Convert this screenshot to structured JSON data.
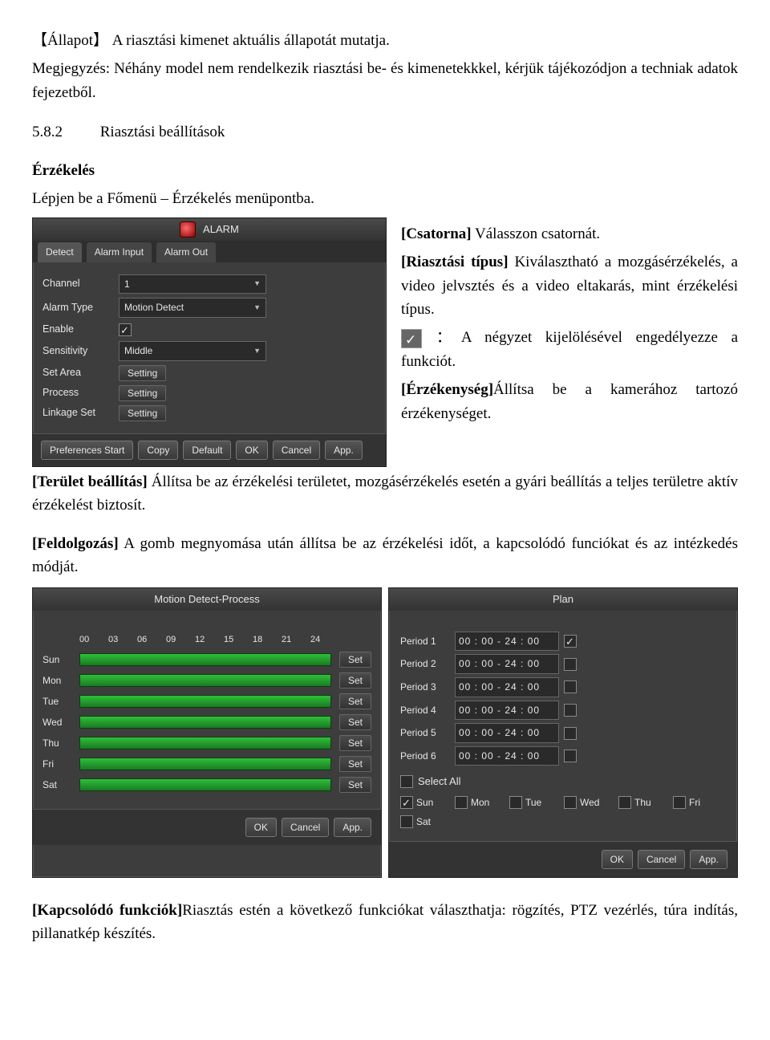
{
  "doc": {
    "line1_pre": "【Állapot】",
    "line1_rest": "A riasztási kimenet aktuális állapotát mutatja.",
    "line2": "Megjegyzés: Néhány model nem rendelkezik riasztási be- és kimenetekkkel, kérjük tájékozódjon a techniak adatok fejezetből.",
    "sec_num": "5.8.2",
    "sec_title": "Riasztási beállítások",
    "sense_h": "Érzékelés",
    "sense_p": "Lépjen be a Főmenü – Érzékelés menüpontba.",
    "ch_label": "[Csatorna]",
    "ch_text": " Válasszon csatornát.",
    "rt_label": "[Riasztási típus]",
    "rt_text": " Kiválasztható a mozgásérzékelés, a video jelvsztés és a video eltakarás, mint érzékelési típus.",
    "chk_text": "：A négyzet kijelölésével engedélyezze a funkciót.",
    "sens_label": "[Érzékenység]",
    "sens_text": "Állítsa be a kamerához tartozó érzékenységet.",
    "area_label": "[Terület beállítás]",
    "area_text": " Állítsa be az érzékelési területet, mozgásérzékelés esetén a gyári beállítás a teljes területre aktív érzékelést biztosít.",
    "proc_label": "[Feldolgozás]",
    "proc_text": " A gomb megnyomása után állítsa be az érzékelési időt, a kapcsolódó funciókat és az intézkedés módját.",
    "link_label": "[Kapcsolódó funkciók]",
    "link_text": "Riasztás estén a következő funkciókat választhatja: rögzítés, PTZ vezérlés, túra indítás, pillanatkép készítés."
  },
  "alarm": {
    "title": "ALARM",
    "tabs": [
      "Detect",
      "Alarm Input",
      "Alarm Out"
    ],
    "rows": {
      "channel": "Channel",
      "channel_v": "1",
      "atype": "Alarm Type",
      "atype_v": "Motion Detect",
      "enable": "Enable",
      "sens": "Sensitivity",
      "sens_v": "Middle",
      "area": "Set Area",
      "process": "Process",
      "linkage": "Linkage Set",
      "setting": "Setting"
    },
    "btns": [
      "Preferences Start",
      "Copy",
      "Default",
      "OK",
      "Cancel",
      "App."
    ]
  },
  "mdp": {
    "title": "Motion Detect-Process",
    "hours": [
      "00",
      "03",
      "06",
      "09",
      "12",
      "15",
      "18",
      "21",
      "24"
    ],
    "days": [
      "Sun",
      "Mon",
      "Tue",
      "Wed",
      "Thu",
      "Fri",
      "Sat"
    ],
    "set": "Set",
    "btns": [
      "OK",
      "Cancel",
      "App."
    ]
  },
  "plan": {
    "title": "Plan",
    "periods": [
      {
        "label": "Period 1",
        "v": "00 : 00 - 24 : 00",
        "chk": true
      },
      {
        "label": "Period 2",
        "v": "00 : 00 - 24 : 00",
        "chk": false
      },
      {
        "label": "Period 3",
        "v": "00 : 00 - 24 : 00",
        "chk": false
      },
      {
        "label": "Period 4",
        "v": "00 : 00 - 24 : 00",
        "chk": false
      },
      {
        "label": "Period 5",
        "v": "00 : 00 - 24 : 00",
        "chk": false
      },
      {
        "label": "Period 6",
        "v": "00 : 00 - 24 : 00",
        "chk": false
      }
    ],
    "select_all": "Select All",
    "days": [
      {
        "n": "Sun",
        "c": true
      },
      {
        "n": "Mon",
        "c": false
      },
      {
        "n": "Tue",
        "c": false
      },
      {
        "n": "Wed",
        "c": false
      },
      {
        "n": "Thu",
        "c": false
      },
      {
        "n": "Fri",
        "c": false
      },
      {
        "n": "Sat",
        "c": false
      }
    ],
    "btns": [
      "OK",
      "Cancel",
      "App."
    ]
  }
}
